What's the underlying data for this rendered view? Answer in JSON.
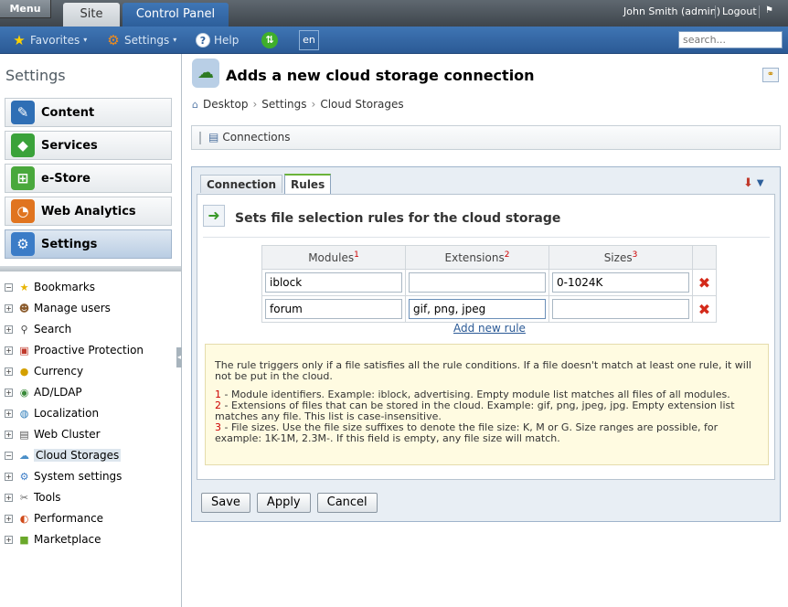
{
  "topbar": {
    "menu_label": "Menu",
    "tabs": [
      {
        "label": "Site"
      },
      {
        "label": "Control Panel"
      }
    ],
    "user": "John Smith (admin)",
    "logout": "Logout"
  },
  "toolbar": {
    "favorites": "Favorites",
    "settings": "Settings",
    "help": "Help",
    "language": "en",
    "search_placeholder": "search..."
  },
  "sidebar": {
    "title": "Settings",
    "sections": [
      {
        "label": "Content"
      },
      {
        "label": "Services"
      },
      {
        "label": "e-Store"
      },
      {
        "label": "Web Analytics"
      },
      {
        "label": "Settings"
      }
    ],
    "tree": [
      {
        "label": "Bookmarks"
      },
      {
        "label": "Manage users"
      },
      {
        "label": "Search"
      },
      {
        "label": "Proactive Protection"
      },
      {
        "label": "Currency"
      },
      {
        "label": "AD/LDAP"
      },
      {
        "label": "Localization"
      },
      {
        "label": "Web Cluster"
      },
      {
        "label": "Cloud Storages"
      },
      {
        "label": "System settings"
      },
      {
        "label": "Tools"
      },
      {
        "label": "Performance"
      },
      {
        "label": "Marketplace"
      }
    ]
  },
  "main": {
    "title": "Adds a new cloud storage connection",
    "breadcrumb": [
      "Desktop",
      "Settings",
      "Cloud Storages"
    ],
    "connections_button": "Connections",
    "tabs": [
      {
        "label": "Connection"
      },
      {
        "label": "Rules"
      }
    ],
    "section_title": "Sets file selection rules for the cloud storage",
    "table": {
      "headers": [
        {
          "label": "Modules",
          "sup": "1"
        },
        {
          "label": "Extensions",
          "sup": "2"
        },
        {
          "label": "Sizes",
          "sup": "3"
        }
      ],
      "rows": [
        {
          "module": "iblock",
          "extensions": "",
          "sizes": "0-1024K"
        },
        {
          "module": "forum",
          "extensions": "gif, png, jpeg",
          "sizes": ""
        }
      ]
    },
    "add_rule": "Add new rule",
    "note": {
      "intro": "The rule triggers only if a file satisfies all the rule conditions. If a file doesn't match at least one rule, it will not be put in the cloud.",
      "items": [
        {
          "num": "1",
          "text": " - Module identifiers. Example: iblock, advertising. Empty module list matches all files of all modules."
        },
        {
          "num": "2",
          "text": " - Extensions of files that can be stored in the cloud. Example: gif, png, jpeg, jpg. Empty extension list matches any file. This list is case-insensitive."
        },
        {
          "num": "3",
          "text": " - File sizes. Use the file size suffixes to denote the file size: K, M or G. Size ranges are possible, for example: 1K-1M, 2.3M-. If this field is empty, any file size will match."
        }
      ]
    },
    "buttons": {
      "save": "Save",
      "apply": "Apply",
      "cancel": "Cancel"
    }
  },
  "colors": {
    "accent": "#2d5f9b",
    "note_bg": "#fffbe1",
    "delete": "#d42a1a"
  }
}
